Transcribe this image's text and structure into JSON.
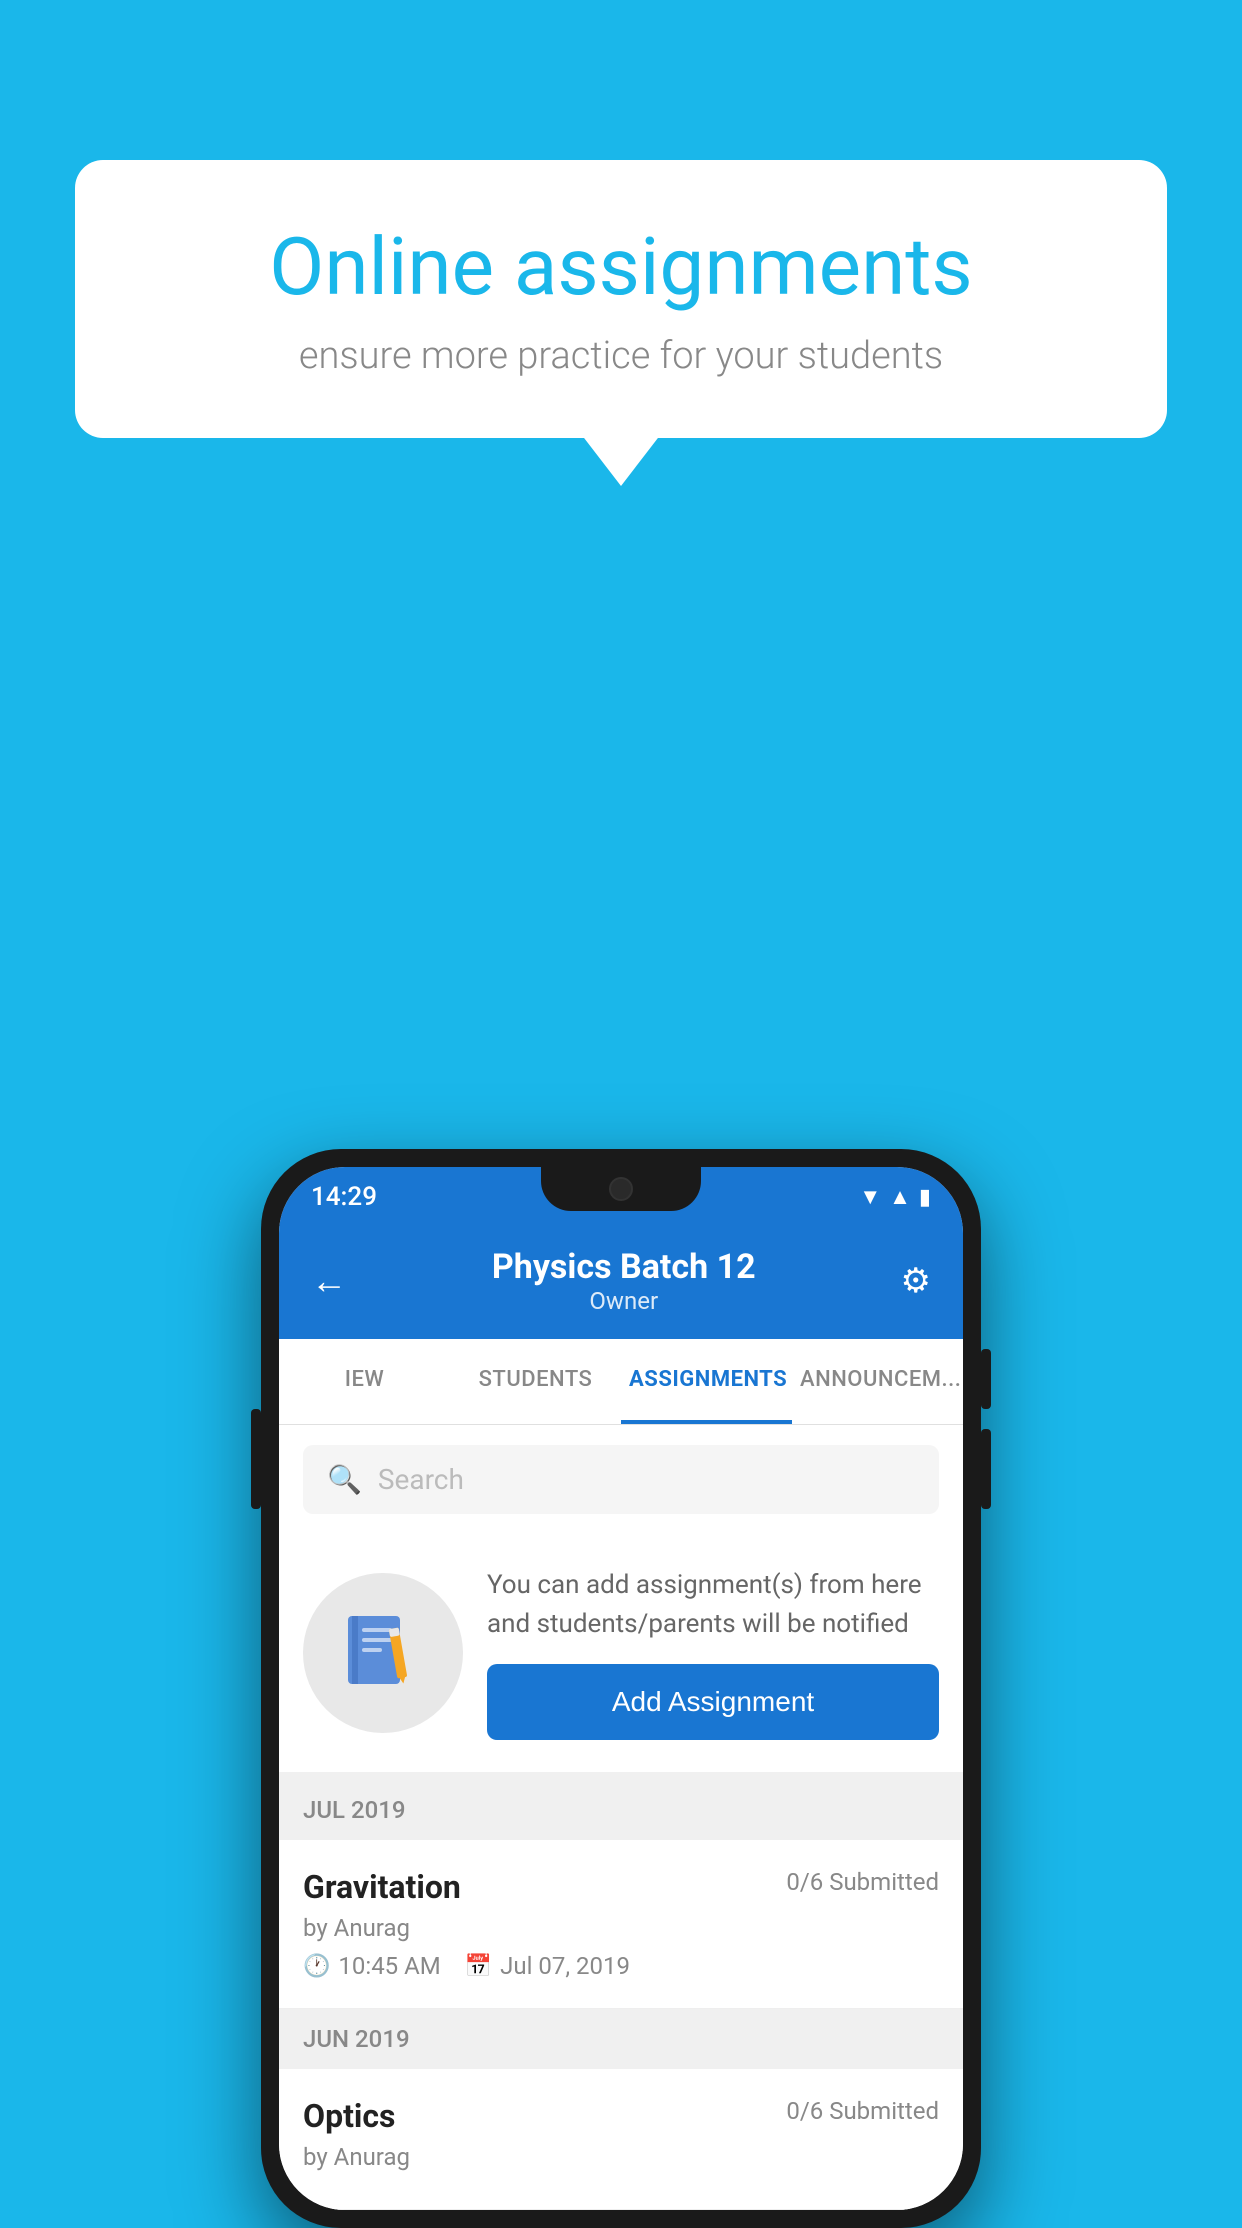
{
  "background_color": "#1ab7ea",
  "speech_bubble": {
    "title": "Online assignments",
    "subtitle": "ensure more practice for your students"
  },
  "phone": {
    "status_bar": {
      "time": "14:29",
      "icons": [
        "wifi",
        "signal",
        "battery"
      ]
    },
    "header": {
      "title": "Physics Batch 12",
      "subtitle": "Owner",
      "back_label": "←",
      "settings_label": "⚙"
    },
    "tabs": [
      {
        "label": "IEW",
        "active": false
      },
      {
        "label": "STUDENTS",
        "active": false
      },
      {
        "label": "ASSIGNMENTS",
        "active": true
      },
      {
        "label": "ANNOUNCEM...",
        "active": false
      }
    ],
    "search": {
      "placeholder": "Search"
    },
    "promo": {
      "text": "You can add assignment(s) from here and students/parents will be notified",
      "button_label": "Add Assignment"
    },
    "sections": [
      {
        "month_label": "JUL 2019",
        "assignments": [
          {
            "title": "Gravitation",
            "submitted": "0/6 Submitted",
            "by": "by Anurag",
            "time": "10:45 AM",
            "date": "Jul 07, 2019"
          }
        ]
      },
      {
        "month_label": "JUN 2019",
        "assignments": [
          {
            "title": "Optics",
            "submitted": "0/6 Submitted",
            "by": "by Anurag",
            "time": "",
            "date": ""
          }
        ]
      }
    ]
  }
}
